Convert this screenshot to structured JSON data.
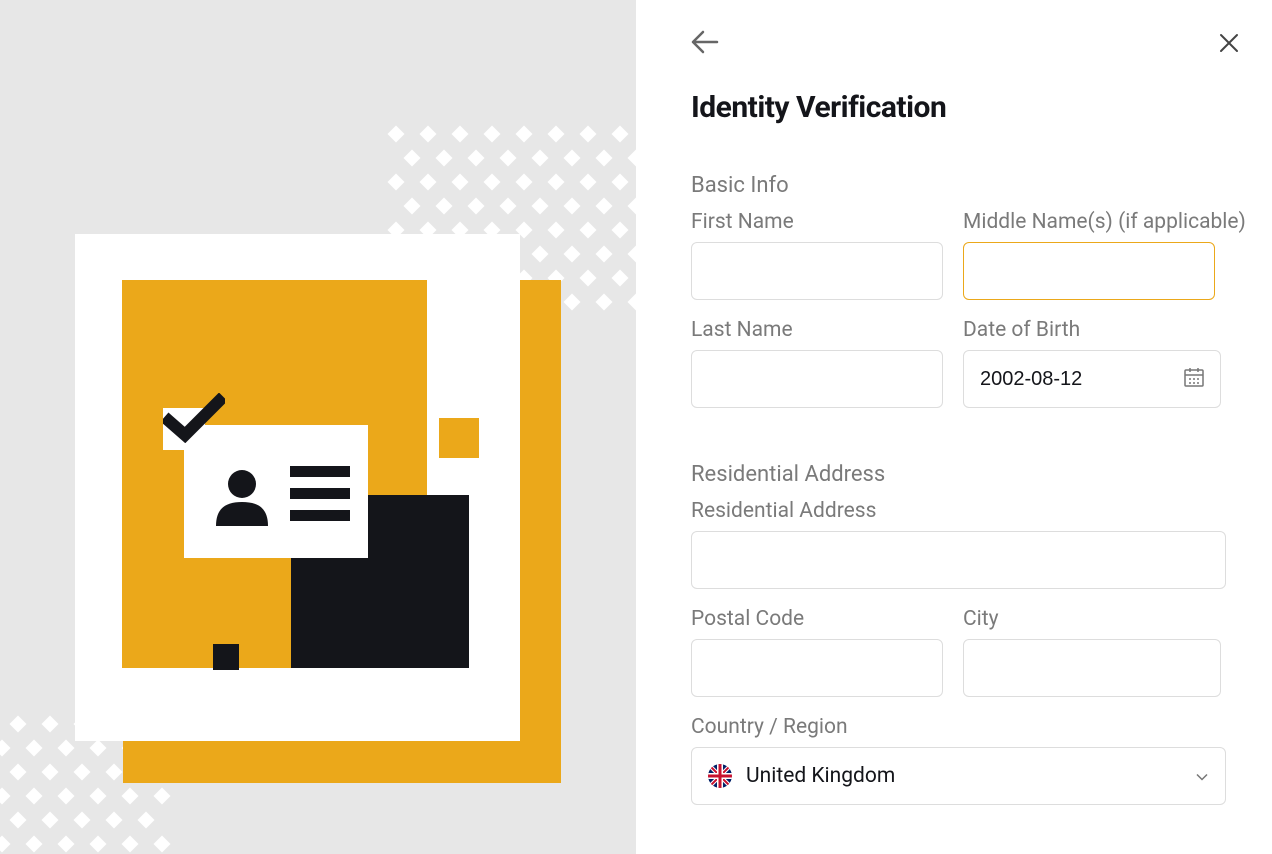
{
  "title": "Identity Verification",
  "sections": {
    "basic_info": {
      "label": "Basic Info",
      "first_name": {
        "label": "First Name",
        "value": ""
      },
      "middle_name": {
        "label": "Middle Name(s) (if applicable)",
        "value": ""
      },
      "last_name": {
        "label": "Last Name",
        "value": ""
      },
      "dob": {
        "label": "Date of Birth",
        "value": "2002-08-12"
      }
    },
    "residential": {
      "label": "Residential Address",
      "address": {
        "label": "Residential Address",
        "value": ""
      },
      "postal_code": {
        "label": "Postal Code",
        "value": ""
      },
      "city": {
        "label": "City",
        "value": ""
      },
      "country": {
        "label": "Country / Region",
        "value": "United Kingdom"
      }
    }
  },
  "icons": {
    "back": "arrow-left-icon",
    "close": "close-icon",
    "calendar": "calendar-icon",
    "chevron": "chevron-down-icon",
    "flag": "uk-flag-icon"
  }
}
